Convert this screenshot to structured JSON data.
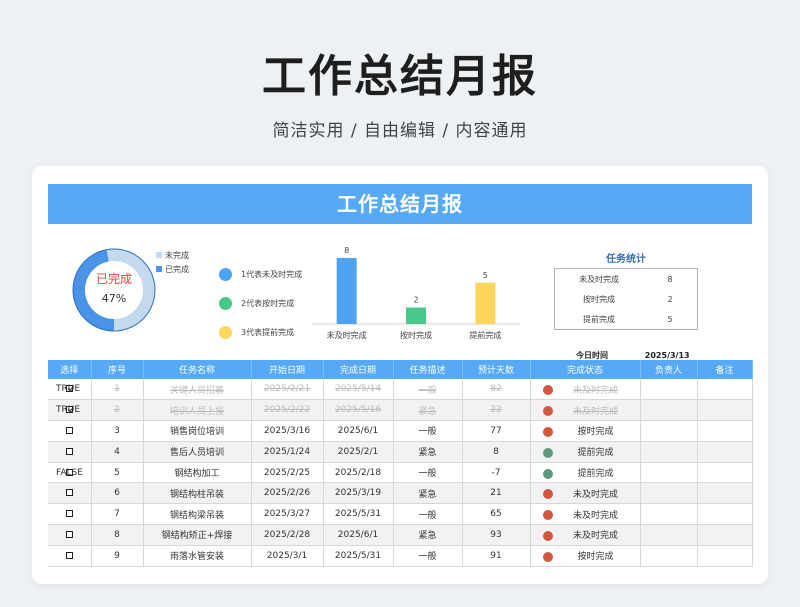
{
  "hero": {
    "title": "工作总结月报",
    "subtitle": "简洁实用 / 自由编辑 / 内容通用"
  },
  "banner": {
    "title": "工作总结月报"
  },
  "donut": {
    "status_label": "已完成",
    "percent_label": "47%",
    "completed_fraction": 0.47,
    "legend": [
      {
        "label": "未完成",
        "color": "#c2d9ee"
      },
      {
        "label": "已完成",
        "color": "#4a94e8"
      }
    ]
  },
  "code_legend": [
    {
      "label": "1代表未及时完成",
      "color": "#4fa3f5"
    },
    {
      "label": "2代表按时完成",
      "color": "#48c98a"
    },
    {
      "label": "3代表提前完成",
      "color": "#ffd65c"
    }
  ],
  "chart_data": {
    "type": "bar",
    "categories": [
      "未及时完成",
      "按时完成",
      "提前完成"
    ],
    "values": [
      8,
      2,
      5
    ],
    "colors": [
      "#4fa3f5",
      "#48c98a",
      "#ffd65c"
    ],
    "ylim": [
      0,
      8
    ],
    "data_labels": true,
    "grid": false
  },
  "stats": {
    "title": "任务统计",
    "rows": [
      {
        "label": "未及时完成",
        "value": "8"
      },
      {
        "label": "按时完成",
        "value": "2"
      },
      {
        "label": "提前完成",
        "value": "5"
      }
    ]
  },
  "today": {
    "label": "今日时间",
    "value": "2025/3/13"
  },
  "table": {
    "headers": [
      "选择",
      "序号",
      "任务名称",
      "开始日期",
      "完成日期",
      "任务描述",
      "预计天数",
      "完成状态",
      "负责人",
      "备注"
    ],
    "status_colors": {
      "red": "#d2573c",
      "green": "#5c9a7d"
    },
    "rows": [
      {
        "bool": "TRUE",
        "checked": true,
        "no": "1",
        "name": "关键人员招募",
        "start": "2025/2/21",
        "end": "2025/5/14",
        "desc": "一般",
        "days": "82",
        "dot": "red",
        "status": "未及时完成",
        "owner": "",
        "note": ""
      },
      {
        "bool": "TRUE",
        "checked": true,
        "no": "2",
        "name": "培训人员上报",
        "start": "2025/2/22",
        "end": "2025/5/16",
        "desc": "紧急",
        "days": "22",
        "dot": "red",
        "status": "未及时完成",
        "owner": "",
        "note": ""
      },
      {
        "bool": "",
        "checked": false,
        "no": "3",
        "name": "销售岗位培训",
        "start": "2025/3/16",
        "end": "2025/6/1",
        "desc": "一般",
        "days": "77",
        "dot": "red",
        "status": "按时完成",
        "owner": "",
        "note": ""
      },
      {
        "bool": "",
        "checked": false,
        "no": "4",
        "name": "售后人员培训",
        "start": "2025/1/24",
        "end": "2025/2/1",
        "desc": "紧急",
        "days": "8",
        "dot": "green",
        "status": "提前完成",
        "owner": "",
        "note": ""
      },
      {
        "bool": "FALSE",
        "checked": false,
        "no": "5",
        "name": "钢结构加工",
        "start": "2025/2/25",
        "end": "2025/2/18",
        "desc": "一般",
        "days": "-7",
        "dot": "green",
        "status": "提前完成",
        "owner": "",
        "note": ""
      },
      {
        "bool": "",
        "checked": false,
        "no": "6",
        "name": "钢结构柱吊装",
        "start": "2025/2/26",
        "end": "2025/3/19",
        "desc": "紧急",
        "days": "21",
        "dot": "red",
        "status": "未及时完成",
        "owner": "",
        "note": ""
      },
      {
        "bool": "",
        "checked": false,
        "no": "7",
        "name": "钢结构梁吊装",
        "start": "2025/3/27",
        "end": "2025/5/31",
        "desc": "一般",
        "days": "65",
        "dot": "red",
        "status": "未及时完成",
        "owner": "",
        "note": ""
      },
      {
        "bool": "",
        "checked": false,
        "no": "8",
        "name": "钢结构矫正+焊接",
        "start": "2025/2/28",
        "end": "2025/6/1",
        "desc": "紧急",
        "days": "93",
        "dot": "red",
        "status": "未及时完成",
        "owner": "",
        "note": ""
      },
      {
        "bool": "",
        "checked": false,
        "no": "9",
        "name": "雨落水管安装",
        "start": "2025/3/1",
        "end": "2025/5/31",
        "desc": "一般",
        "days": "91",
        "dot": "red",
        "status": "按时完成",
        "owner": "",
        "note": ""
      }
    ]
  }
}
